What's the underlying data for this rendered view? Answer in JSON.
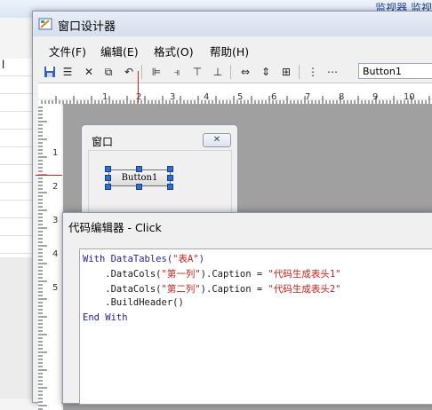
{
  "background": {
    "top_links": "监视器 监视",
    "left_label": "l"
  },
  "designer": {
    "title": "窗口设计器",
    "menu": [
      {
        "label": "文件(F)"
      },
      {
        "label": "编辑(E)"
      },
      {
        "label": "格式(O)"
      },
      {
        "label": "帮助(H)"
      }
    ],
    "toolbar_icons": [
      "save-icon",
      "align-icon",
      "delete-icon",
      "copy-icon",
      "undo-icon",
      "align-left-icon",
      "align-right-icon",
      "align-top-icon",
      "align-bottom-icon",
      "same-width-icon",
      "same-height-icon",
      "same-size-icon",
      "space-vertical-icon",
      "space-horizontal-icon"
    ],
    "control_selector": "Button1",
    "ruler_top_numbers": [
      "1",
      "2",
      "3",
      "4",
      "5",
      "6",
      "7",
      "8",
      "9",
      "10"
    ],
    "ruler_left_numbers": [
      "1",
      "2",
      "3",
      "4",
      "5"
    ]
  },
  "form": {
    "title": "窗口",
    "close_glyph": "✕",
    "button_label": "Button1"
  },
  "editor": {
    "title": "代码编辑器 - Click",
    "code": [
      [
        {
          "t": "kw",
          "v": "With DataTables("
        },
        {
          "t": "str",
          "v": "\"表A\""
        },
        {
          "t": "kw",
          "v": ")"
        }
      ],
      [
        {
          "t": "plain",
          "v": "    .DataCols("
        },
        {
          "t": "str",
          "v": "\"第一列\""
        },
        {
          "t": "plain",
          "v": ").Caption = "
        },
        {
          "t": "str",
          "v": "\"代码生成表头1\""
        }
      ],
      [
        {
          "t": "plain",
          "v": "    .DataCols("
        },
        {
          "t": "str",
          "v": "\"第二列\""
        },
        {
          "t": "plain",
          "v": ").Caption = "
        },
        {
          "t": "str",
          "v": "\"代码生成表头2\""
        }
      ],
      [
        {
          "t": "plain",
          "v": "    .BuildHeader()"
        }
      ],
      [
        {
          "t": "kw",
          "v": "End With"
        }
      ]
    ]
  },
  "colors": {
    "keyword": "#1f1fa8",
    "string": "#c8201a",
    "selection_handle": "#2e6fd0",
    "guide": "#e02020"
  }
}
